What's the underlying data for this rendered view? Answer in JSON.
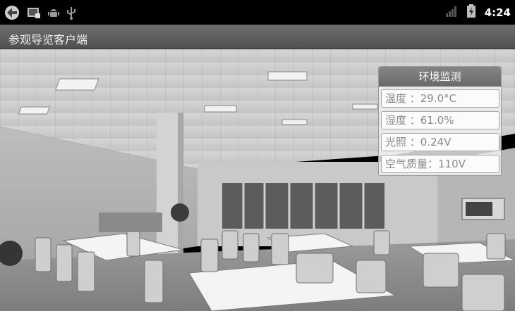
{
  "status_bar": {
    "time": "4:24",
    "icons": [
      "app-icon",
      "screenshot-icon",
      "android-debug-icon",
      "usb-icon",
      "signal-icon",
      "battery-charging-icon"
    ]
  },
  "app": {
    "title": "参观导览客户端"
  },
  "env_panel": {
    "title": "环境监测",
    "rows": [
      {
        "text": "温度 ：29.0°C"
      },
      {
        "text": "湿度 ：61.0%"
      },
      {
        "text": "光照 ：0.24V"
      },
      {
        "text": "空气质量：110V"
      }
    ]
  },
  "colors": {
    "status_bar_bg": "#000000",
    "title_bar_bg": "#606060",
    "panel_header": "#757575",
    "row_text": "#8a8a8a"
  }
}
